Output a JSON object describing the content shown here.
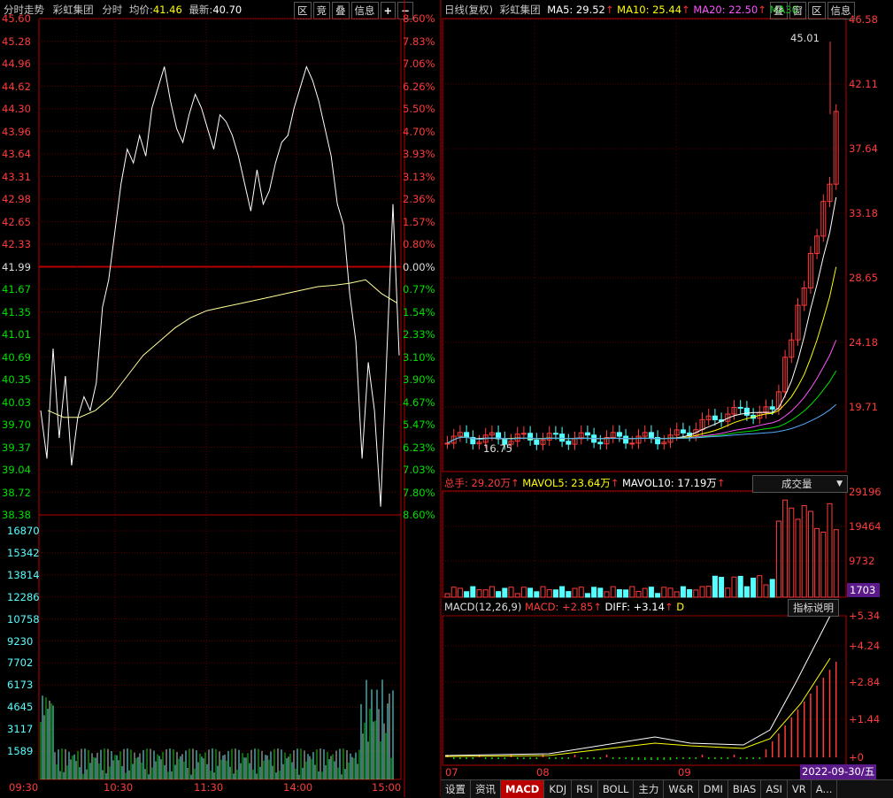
{
  "left": {
    "header": {
      "title": "分时走势",
      "stock": "彩虹集团",
      "mode": "分时",
      "avg_label": "均价:",
      "avg_value": "41.46",
      "last_label": "最新:",
      "last_value": "40.70",
      "buttons": [
        "区",
        "竞",
        "叠",
        "信息"
      ],
      "plus": "+",
      "minus": "−"
    },
    "price_ticks": [
      "45.60",
      "45.28",
      "44.96",
      "44.62",
      "44.30",
      "43.96",
      "43.64",
      "43.31",
      "42.98",
      "42.65",
      "42.33",
      "41.99",
      "41.67",
      "41.35",
      "41.01",
      "40.69",
      "40.35",
      "40.03",
      "39.70",
      "39.37",
      "39.04",
      "38.72",
      "38.38"
    ],
    "pct_ticks": [
      "8.60%",
      "7.83%",
      "7.06%",
      "6.26%",
      "5.50%",
      "4.70%",
      "3.93%",
      "3.13%",
      "2.36%",
      "1.57%",
      "0.80%",
      "0.00%",
      "0.77%",
      "1.54%",
      "2.33%",
      "3.10%",
      "3.90%",
      "4.67%",
      "5.47%",
      "6.23%",
      "7.03%",
      "7.80%",
      "8.60%"
    ],
    "vol_ticks": [
      "16870",
      "15342",
      "13814",
      "12286",
      "10758",
      "9230",
      "7702",
      "6173",
      "4645",
      "3117",
      "1589"
    ],
    "time_ticks": [
      "09:30",
      "10:30",
      "11:30",
      "14:00",
      "15:00"
    ]
  },
  "right": {
    "header": {
      "label": "日线(复权)",
      "stock": "彩虹集团",
      "ma5": "MA5: 29.52",
      "ma10": "MA10: 25.44",
      "ma20": "MA20: 22.50",
      "ma30": "MA30",
      "buttons": [
        "叠",
        "窗",
        "区",
        "信息"
      ]
    },
    "price_ticks": [
      "46.58",
      "42.11",
      "37.64",
      "33.18",
      "28.65",
      "24.18",
      "19.71"
    ],
    "high_label": "45.01",
    "low_label": "16.75",
    "vol_header": {
      "total": "总手: 29.20万",
      "mavol5": "MAVOL5: 23.64万",
      "mavol10": "MAVOL10: 17.19万",
      "dropdown": "成交量"
    },
    "vol_ticks": [
      "29196",
      "19464",
      "9732"
    ],
    "vol_current": "1703",
    "macd_header": {
      "label": "MACD(12,26,9)",
      "macd": "MACD: +2.85",
      "diff": "DIFF: +3.14",
      "dea": "D",
      "button": "指标说明"
    },
    "macd_ticks": [
      "+5.34",
      "+4.24",
      "+2.84",
      "+1.44",
      "+0"
    ],
    "month_ticks": [
      "07",
      "08",
      "09"
    ],
    "date_badge": "2022-09-30/五",
    "tabs": [
      "设置",
      "资讯",
      "MACD",
      "KDJ",
      "RSI",
      "BOLL",
      "主力",
      "W&R",
      "DMI",
      "BIAS",
      "ASI",
      "VR",
      "A..."
    ],
    "active_tab": "MACD"
  },
  "colors": {
    "up": "#ff3b3b",
    "down": "#00e000",
    "grid": "#7a0000",
    "axis": "#b40000",
    "yellow": "#ffff00",
    "magenta": "#ff55ff",
    "cyan": "#55ffff"
  }
}
